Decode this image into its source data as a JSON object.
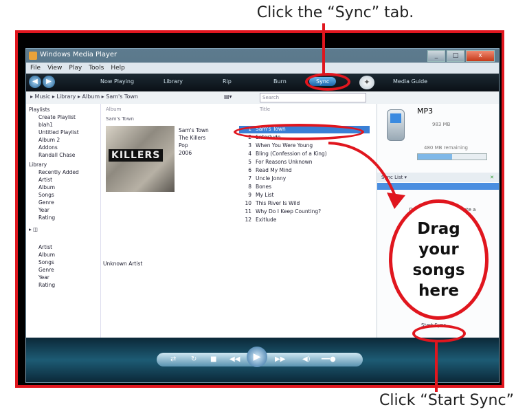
{
  "annotations": {
    "top": "Click the “Sync” tab.",
    "bottom": "Click “Start Sync”",
    "drag_lines": [
      "Drag",
      "your",
      "songs",
      "here"
    ]
  },
  "window": {
    "title": "Windows Media Player",
    "controls": [
      "_",
      "□",
      "x"
    ]
  },
  "menu": [
    "File",
    "View",
    "Play",
    "Tools",
    "Help"
  ],
  "tabs": [
    "Now Playing",
    "Library",
    "Rip",
    "Burn",
    "Sync",
    "Media Guide"
  ],
  "active_tab": "Sync",
  "address": {
    "crumbs": "▸ Music ▸ Library ▸ Album ▸ Sam's Town",
    "search_placeholder": "Search"
  },
  "nav": {
    "playlists_header": "Playlists",
    "playlists": [
      "Create Playlist",
      "blah1",
      "Untitled Playlist",
      "Album 2",
      "Addons",
      "Randall Chase"
    ],
    "library_header": "Library",
    "library": [
      "Recently Added",
      "Artist",
      "Album",
      "Songs",
      "Genre",
      "Year",
      "Rating"
    ],
    "other": [
      "Artist",
      "Album",
      "Songs",
      "Genre",
      "Year",
      "Rating"
    ]
  },
  "columns": {
    "album": "Album",
    "title": "Title"
  },
  "album": {
    "group": "Sam's Town",
    "art_text": "KILLERS",
    "info": [
      "Sam's Town",
      "The Killers",
      "Pop",
      "2006"
    ]
  },
  "tracks": [
    {
      "num": "1",
      "title": "Sam's Town"
    },
    {
      "num": "2",
      "title": "Enterlude"
    },
    {
      "num": "3",
      "title": "When You Were Young"
    },
    {
      "num": "4",
      "title": "Bling (Confession of a King)"
    },
    {
      "num": "5",
      "title": "For Reasons Unknown"
    },
    {
      "num": "6",
      "title": "Read My Mind"
    },
    {
      "num": "7",
      "title": "Uncle Jonny"
    },
    {
      "num": "8",
      "title": "Bones"
    },
    {
      "num": "9",
      "title": "My List"
    },
    {
      "num": "10",
      "title": "This River Is Wild"
    },
    {
      "num": "11",
      "title": "Why Do I Keep Counting?"
    },
    {
      "num": "12",
      "title": "Exitlude"
    }
  ],
  "selected_track": 0,
  "unknown_label": "Unknown Artist",
  "device": {
    "name": "MP3",
    "capacity": "983 MB",
    "free": "480 MB remaining",
    "used_fraction": 0.5
  },
  "sync_list_label": "Sync List ▾",
  "drag_hint": "Drag items here to create a sync list",
  "start_sync": "Start Sync",
  "colors": {
    "annotation": "#e0161e",
    "active_tab": "#1c64a8",
    "selection": "#3a7fd5"
  }
}
